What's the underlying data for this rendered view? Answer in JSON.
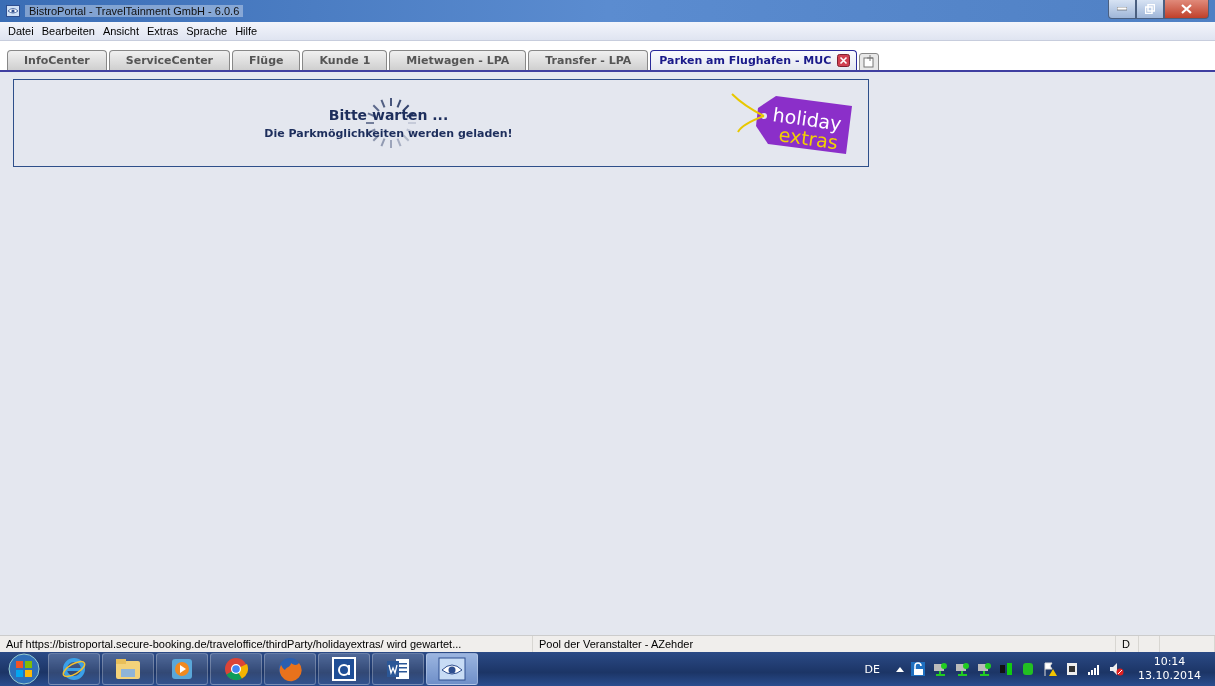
{
  "window": {
    "title": "BistroPortal - TravelTainment GmbH - 6.0.6"
  },
  "menu": [
    "Datei",
    "Bearbeiten",
    "Ansicht",
    "Extras",
    "Sprache",
    "Hilfe"
  ],
  "tabs": [
    {
      "label": "InfoCenter",
      "selected": false
    },
    {
      "label": "ServiceCenter",
      "selected": false
    },
    {
      "label": "Flüge",
      "selected": false
    },
    {
      "label": "Kunde 1",
      "selected": false
    },
    {
      "label": "Mietwagen - LPA",
      "selected": false
    },
    {
      "label": "Transfer - LPA",
      "selected": false
    },
    {
      "label": "Parken am Flughafen - MUC",
      "selected": true
    }
  ],
  "loading": {
    "title": "Bitte warten ...",
    "message": "Die Parkmöglichkeiten werden geladen!",
    "logo": [
      "holiday",
      "extras"
    ]
  },
  "status_bar": {
    "message": "Auf https://bistroportal.secure-booking.de/traveloffice/thirdParty/holidayextras/ wird gewartet...",
    "pool": "Pool der Veranstalter  - AZehder",
    "field_3": "D"
  },
  "taskbar": {
    "apps": [
      {
        "kind": "ie",
        "selected": false
      },
      {
        "kind": "folder",
        "selected": false
      },
      {
        "kind": "media",
        "selected": false
      },
      {
        "kind": "chrome",
        "selected": false
      },
      {
        "kind": "firefox",
        "selected": false
      },
      {
        "kind": "reader",
        "selected": false
      },
      {
        "kind": "word",
        "selected": false
      },
      {
        "kind": "eye",
        "selected": true
      }
    ],
    "language": "DE",
    "time": "10:14",
    "date": "13.10.2014"
  }
}
